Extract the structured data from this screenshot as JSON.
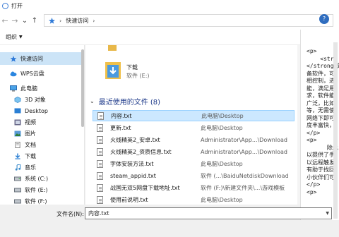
{
  "window": {
    "title": "打开"
  },
  "address": {
    "crumbs": [
      "快速访问"
    ]
  },
  "toolbar": {
    "organize_label": "组织"
  },
  "nav": {
    "items": [
      {
        "label": "快速访问",
        "icon": "star-icon",
        "selected": true
      },
      {
        "label": "WPS云盘",
        "icon": "cloud-icon"
      },
      {
        "label": "此电脑",
        "icon": "computer-icon"
      },
      {
        "label": "3D 对象",
        "icon": "cube-icon"
      },
      {
        "label": "Desktop",
        "icon": "desktop-icon"
      },
      {
        "label": "视频",
        "icon": "video-icon"
      },
      {
        "label": "图片",
        "icon": "picture-icon"
      },
      {
        "label": "文档",
        "icon": "document-icon"
      },
      {
        "label": "下载",
        "icon": "download-icon"
      },
      {
        "label": "音乐",
        "icon": "music-icon"
      },
      {
        "label": "系统 (C:)",
        "icon": "drive-icon"
      },
      {
        "label": "软件 (E:)",
        "icon": "drive-icon"
      },
      {
        "label": "软件 (F:)",
        "icon": "drive-icon"
      }
    ]
  },
  "quick_folder": {
    "name": "下载",
    "location": "软件 (E:)"
  },
  "recent": {
    "header": "最近使用的文件 (8)",
    "files": [
      {
        "name": "内容.txt",
        "location": "此电脑\\Desktop",
        "selected": true
      },
      {
        "name": "更新.txt",
        "location": "此电脑\\Desktop"
      },
      {
        "name": "火线精英2_安卓.txt",
        "location": "Administrator\\App...\\Download"
      },
      {
        "name": "火线精英2_资质信息.txt",
        "location": "Administrator\\App...\\Download"
      },
      {
        "name": "字体安装方法.txt",
        "location": "此电脑\\Desktop"
      },
      {
        "name": "steam_appid.txt",
        "location": "软件 (...\\BaiduNetdiskDownload"
      },
      {
        "name": "战国无双5网盘下载地址.txt",
        "location": "软件 (F:)\\新建文件夹\\...\\游戏模板"
      },
      {
        "name": "使用前说明.txt",
        "location": "此电脑\\Desktop"
      }
    ]
  },
  "preview": {
    "lines": [
      "<p>",
      "    <str",
      "</strong>是",
      "备软件，可",
      "相控制，进",
      "能，满足用",
      "求，软件能",
      "广泛，比如",
      "等，无需使",
      "网络下即可",
      "度丰富快，",
      "</p>",
      "<p>",
      "      除此",
      "以提供了手",
      "以远程触发",
      "有助于找回",
      "小伙伴们可",
      "</p>",
      "<p>"
    ]
  },
  "bottom": {
    "filename_label": "文件名(N):",
    "filename_value": "内容.txt"
  }
}
